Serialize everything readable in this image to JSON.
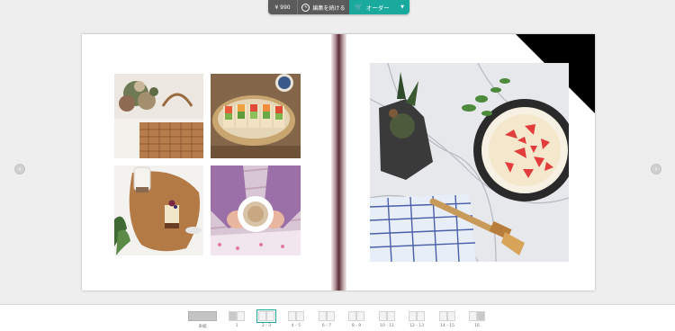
{
  "toolbar": {
    "price": "¥ 990",
    "edit_label": "編集を続ける",
    "order_label": "オーダー",
    "accent_color": "#1aa99d"
  },
  "icons": {
    "edit": "pencil-circle-icon",
    "cart": "cart-icon",
    "caret": "caret-down-icon",
    "prev": "chevron-left-icon",
    "next": "chevron-right-icon"
  },
  "spread": {
    "left_page_photos": [
      "flowers-basket-photo",
      "sandwich-tray-photo",
      "cake-board-photo",
      "coffee-hands-photo"
    ],
    "right_page_photo": "strawberry-tart-photo"
  },
  "thumbnails": [
    {
      "label": "表紙",
      "active": false
    },
    {
      "label": "1",
      "active": false
    },
    {
      "label": "2 - 3",
      "active": true
    },
    {
      "label": "4 - 5",
      "active": false
    },
    {
      "label": "6 - 7",
      "active": false
    },
    {
      "label": "8 - 9",
      "active": false
    },
    {
      "label": "10 - 11",
      "active": false
    },
    {
      "label": "12 - 13",
      "active": false
    },
    {
      "label": "14 - 15",
      "active": false
    },
    {
      "label": "16",
      "active": false
    }
  ]
}
